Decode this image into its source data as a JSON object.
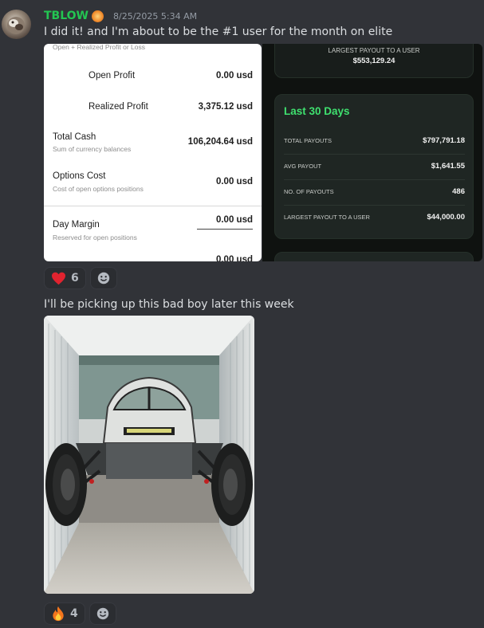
{
  "author": {
    "name": "TBLOW",
    "badge_icon": "sun-badge-icon",
    "timestamp": "8/25/2025 5:34 AM"
  },
  "messages": [
    {
      "text": "I did it! and I'm about to be the #1 user for the month on elite"
    },
    {
      "text": "I'll be picking up this bad boy later this week"
    }
  ],
  "broker_screenshot": {
    "cut_top_text": "Open + Realized Profit or Loss",
    "rows": [
      {
        "label": "Open Profit",
        "sub": "",
        "value": "0.00 usd"
      },
      {
        "label": "Realized Profit",
        "sub": "",
        "value": "3,375.12 usd"
      },
      {
        "label": "Total Cash",
        "sub": "Sum of currency balances",
        "value": "106,204.64 usd"
      },
      {
        "label": "Options Cost",
        "sub": "Cost of open options positions",
        "value": "0.00 usd"
      },
      {
        "label": "Day Margin",
        "sub": "Reserved for open positions",
        "value": "0.00 usd"
      }
    ],
    "cut_bottom_value": "0.00 usd"
  },
  "payout_screenshot": {
    "top_card": {
      "label": "LARGEST PAYOUT TO A USER",
      "value": "$553,129.24"
    },
    "main_card": {
      "title": "Last 30 Days",
      "stats": [
        {
          "label": "TOTAL PAYOUTS",
          "value": "$797,791.18"
        },
        {
          "label": "AVG PAYOUT",
          "value": "$1,641.55"
        },
        {
          "label": "NO. OF PAYOUTS",
          "value": "486"
        },
        {
          "label": "LARGEST PAYOUT TO A USER",
          "value": "$44,000.00"
        }
      ]
    },
    "accent_color": "#3fe06f"
  },
  "reactions_1": [
    {
      "emoji": "❤",
      "count": "6"
    }
  ],
  "reactions_2": [
    {
      "emoji": "🔥",
      "count": "4"
    }
  ],
  "add_reaction_icon": "smiley-add-reaction-icon"
}
